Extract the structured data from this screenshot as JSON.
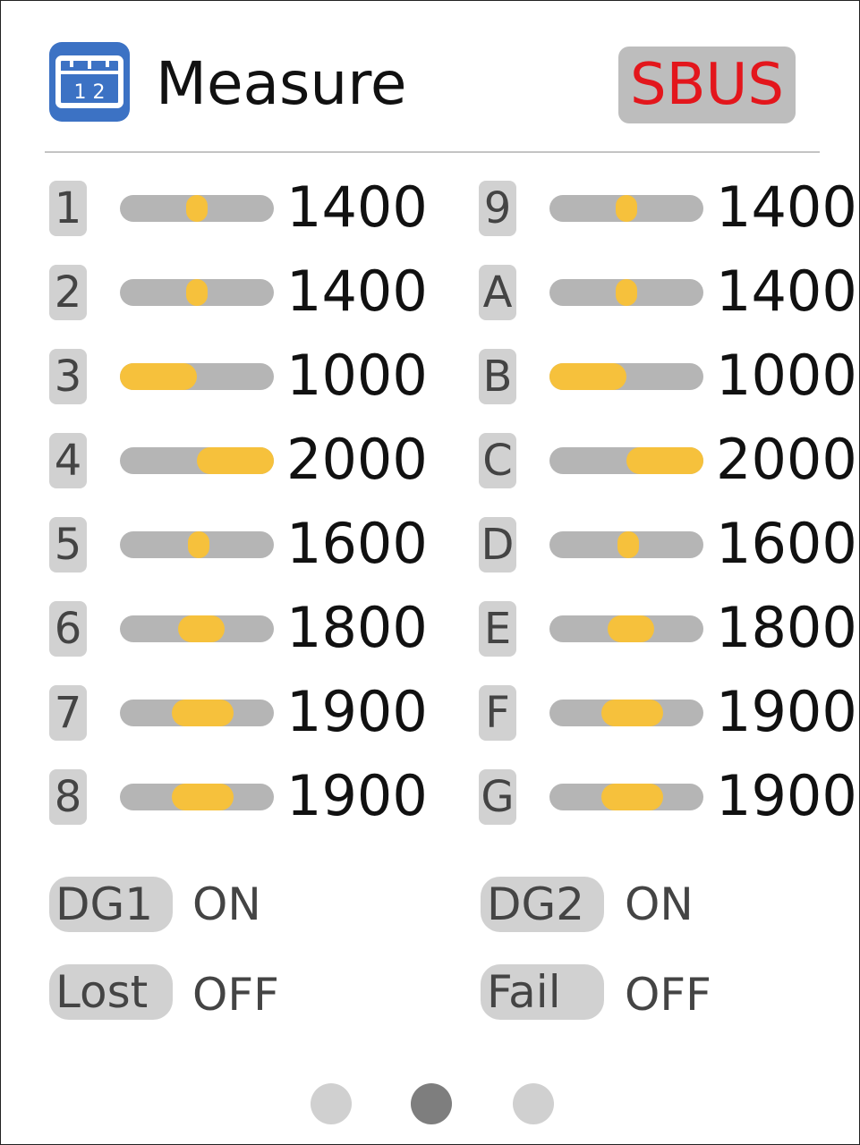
{
  "header": {
    "title": "Measure",
    "app_icon": "ruler-icon",
    "app_icon_text": "1 2",
    "protocol": "SBUS",
    "protocol_color": "#e3161c",
    "accent": "#3c72c4"
  },
  "channels": [
    {
      "label": "1",
      "value": "1400"
    },
    {
      "label": "2",
      "value": "1400"
    },
    {
      "label": "3",
      "value": "1000"
    },
    {
      "label": "4",
      "value": "2000"
    },
    {
      "label": "5",
      "value": "1600"
    },
    {
      "label": "6",
      "value": "1800"
    },
    {
      "label": "7",
      "value": "1900"
    },
    {
      "label": "8",
      "value": "1900"
    },
    {
      "label": "9",
      "value": "1400"
    },
    {
      "label": "A",
      "value": "1400"
    },
    {
      "label": "B",
      "value": "1000"
    },
    {
      "label": "C",
      "value": "2000"
    },
    {
      "label": "D",
      "value": "1600"
    },
    {
      "label": "E",
      "value": "1800"
    },
    {
      "label": "F",
      "value": "1900"
    },
    {
      "label": "G",
      "value": "1900"
    }
  ],
  "channel_range": [
    1000,
    2000
  ],
  "status": {
    "dg1": {
      "label": "DG1",
      "state": "ON"
    },
    "dg2": {
      "label": "DG2",
      "state": "ON"
    },
    "lost": {
      "label": "Lost",
      "state": "OFF"
    },
    "fail": {
      "label": "Fail",
      "state": "OFF"
    }
  },
  "pagination": {
    "pages": 3,
    "current": 2
  },
  "colors": {
    "bar_fill": "#f6c13c",
    "bar_track": "#b5b5b5"
  }
}
